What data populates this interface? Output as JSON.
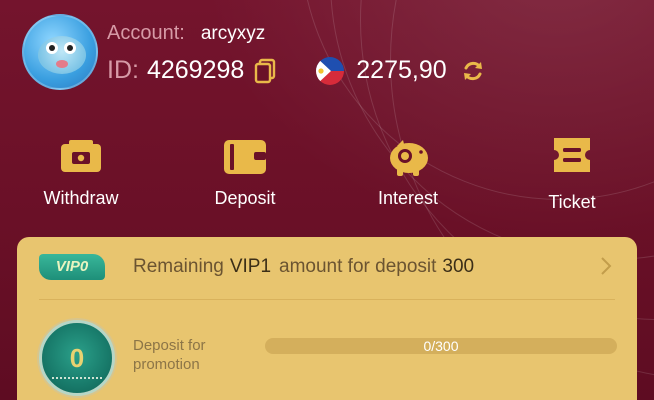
{
  "header": {
    "account_label": "Account:",
    "account_name": "arcyxyz",
    "id_label": "ID:",
    "id_value": "4269298",
    "balance": "2275,90",
    "icons": {
      "avatar": "pufferfish-avatar",
      "copy": "copy-icon",
      "currency_flag": "philippines-flag-icon",
      "refresh": "refresh-icon"
    }
  },
  "actions": [
    {
      "label": "Withdraw",
      "icon": "withdraw-icon"
    },
    {
      "label": "Deposit",
      "icon": "wallet-icon"
    },
    {
      "label": "Interest",
      "icon": "piggy-bank-icon"
    },
    {
      "label": "Ticket",
      "icon": "ticket-icon"
    }
  ],
  "vip": {
    "badge": "VIP0",
    "remaining_prefix": "Remaining",
    "level": "VIP1",
    "amount_text": "amount for deposit",
    "amount": "300",
    "medal_level": "0",
    "deposit_label": "Deposit for promotion",
    "progress_text": "0/300",
    "progress_fraction": 0
  },
  "colors": {
    "background": "#6a1128",
    "accent_gold": "#e9b949",
    "card": "#e8c56f",
    "badge_teal": "#1e8f79"
  }
}
